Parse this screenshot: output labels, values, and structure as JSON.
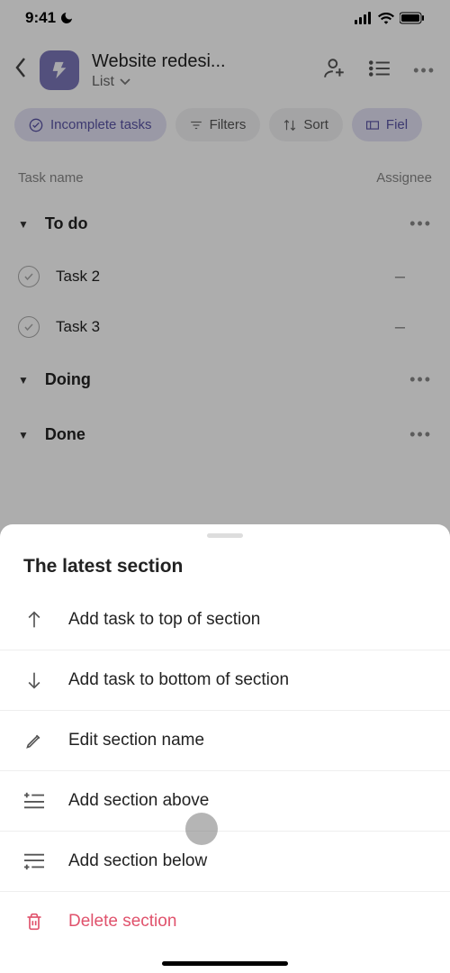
{
  "statusBar": {
    "time": "9:41"
  },
  "header": {
    "projectTitle": "Website redesi...",
    "viewLabel": "List"
  },
  "filters": {
    "incomplete": "Incomplete tasks",
    "filters": "Filters",
    "sort": "Sort",
    "fields": "Fiel"
  },
  "columns": {
    "taskName": "Task name",
    "assignee": "Assignee"
  },
  "sections": [
    {
      "name": "To do"
    },
    {
      "name": "Doing"
    },
    {
      "name": "Done"
    }
  ],
  "tasks": [
    {
      "name": "Task 2",
      "assignee": "–"
    },
    {
      "name": "Task 3",
      "assignee": "–"
    }
  ],
  "sheet": {
    "title": "The latest section",
    "items": {
      "addTop": "Add task to top of section",
      "addBottom": "Add task to bottom of section",
      "edit": "Edit section name",
      "addAbove": "Add section above",
      "addBelow": "Add section below",
      "delete": "Delete section"
    }
  }
}
